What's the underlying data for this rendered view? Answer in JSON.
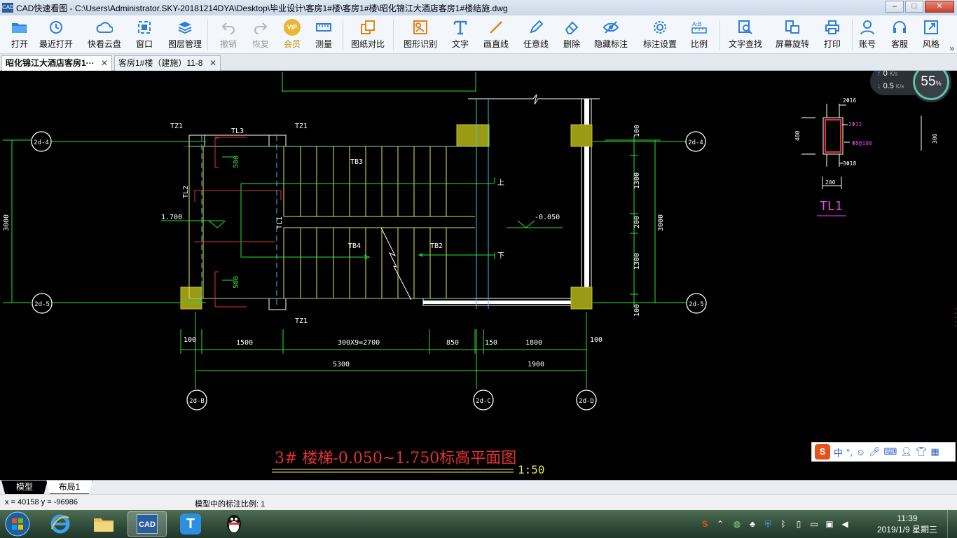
{
  "window": {
    "app_badge": "CAD",
    "title": "CAD快速看图 - C:\\Users\\Administrator.SKY-20181214DYA\\Desktop\\毕业设计\\客房1#楼\\客房1#楼\\昭化锦江大酒店客房1#楼结施.dwg",
    "minimize": "–",
    "maximize": "□",
    "close": "✕"
  },
  "toolbar": {
    "open": "打开",
    "recent": "最近打开",
    "cloud": "快看云盘",
    "window": "窗口",
    "layers": "图层管理",
    "undo": "撤销",
    "redo": "恢复",
    "vip": "会员",
    "vip_badge": "VIP",
    "measure": "测量",
    "compare": "图纸对比",
    "shape_recog": "图形识别",
    "text": "文字",
    "line": "画直线",
    "freeline": "任意线",
    "delete": "删除",
    "hide_marks": "隐藏标注",
    "mark_settings": "标注设置",
    "scale": "比例",
    "find_text": "文字查找",
    "rotate": "屏幕旋转",
    "print": "打印",
    "account": "账号",
    "service": "客服",
    "style": "风格",
    "more": "»"
  },
  "tabs": [
    {
      "label": "昭化锦江大酒店客房1···",
      "close": "✕"
    },
    {
      "label": "客房1#楼（建施）11-8",
      "close": "✕"
    }
  ],
  "net_widget": {
    "up": "0",
    "down": "0.5",
    "unit": "K/s",
    "cpu": "55",
    "cpu_unit": "%"
  },
  "drawing": {
    "title": "3# 楼梯-0.050~1.750标高平面图",
    "scale": "1:50",
    "axes": {
      "c4": "2d-4",
      "c5": "2d-5",
      "r4": "2d-4",
      "r5": "2d-5",
      "b": "2d-B",
      "c": "2d-C",
      "d": "2d-D"
    },
    "labels": {
      "tz1": "TZ1",
      "tl3": "TL3",
      "tl2": "TL2",
      "tl1": "TL1",
      "tb3": "TB3",
      "tb4": "TB4",
      "tb2": "TB2",
      "dim500a": "500",
      "dim500b": "500",
      "elev_left": "1.700",
      "elev_right": "-0.050",
      "dim3000_left": "3000",
      "dim3000_right": "3000",
      "r100a": "100",
      "r1300a": "1300",
      "r200": "200",
      "r1300b": "1300",
      "r100b": "100",
      "h100": "100",
      "h1500": "1500",
      "h2700": "300X9=2700",
      "h850": "850",
      "h150": "150",
      "h1800": "1800",
      "h100b": "100",
      "h5300": "5300",
      "h1900": "1900",
      "up_mark": "上",
      "down_mark": "下"
    },
    "section": {
      "name": "TL1",
      "top_bar": "2Φ16",
      "mid_bar": "2Φ12",
      "stirrup": "Φ8@100",
      "bottom_bar": "3Φ18",
      "height": "400",
      "width": "200",
      "dim300": "300"
    }
  },
  "ime": {
    "logo": "S",
    "lang": "中",
    "punct": "°,"
  },
  "layout_tabs": {
    "model": "模型",
    "layout1": "布局1"
  },
  "status": {
    "coords": "x = 40158  y = -96986",
    "scale_info": "模型中的标注比例: 1"
  },
  "taskbar": {
    "cad": "CAD",
    "t": "T"
  },
  "clock": {
    "time": "11:39",
    "date": "2019/1/9 星期三"
  }
}
